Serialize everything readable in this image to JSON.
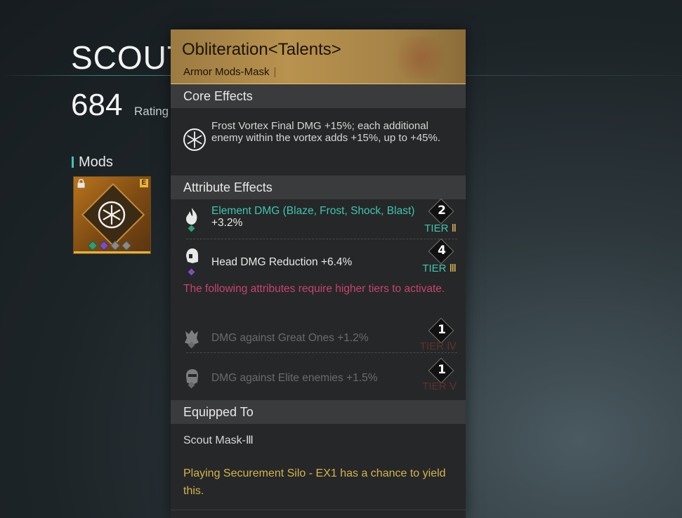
{
  "item": {
    "title": "SCOUT MASK",
    "rating_value": "684",
    "rating_label": "Rating"
  },
  "mods": {
    "label": "Mods",
    "slot_badge": "E",
    "icon": "snowflake-icon",
    "gem_colors": [
      "#2f9e76",
      "#7a4fc0",
      "#8a8a8a",
      "#8a8a8a"
    ]
  },
  "tooltip": {
    "title": "Obliteration<Talents>",
    "subtitle": "Armor Mods-Mask",
    "core_header": "Core Effects",
    "core_text": "Frost Vortex Final DMG +15%; each additional enemy within the vortex adds +15%, up to +45%.",
    "attr_header": "Attribute Effects",
    "attributes": [
      {
        "name": "Element DMG (Blaze, Frost, Shock, Blast)",
        "value": "+3.2%",
        "tier_num": "2",
        "tier_label": "TIER",
        "tier_roman": "Ⅱ",
        "active": true,
        "icon": "flame-icon",
        "gem_color": "#2f9e76"
      },
      {
        "name": "Head DMG Reduction",
        "value": "+6.4%",
        "tier_num": "4",
        "tier_label": "TIER",
        "tier_roman": "Ⅲ",
        "active": true,
        "icon": "helmet-icon",
        "gem_color": "#7a4fc0"
      },
      {
        "name": "DMG against Great Ones",
        "value": "+1.2%",
        "tier_num": "1",
        "tier_label": "TIER",
        "tier_roman": "Ⅳ",
        "active": false,
        "icon": "monster-icon",
        "gem_color": "#6a6a6a"
      },
      {
        "name": "DMG against Elite enemies",
        "value": "+1.5%",
        "tier_num": "1",
        "tier_label": "TIER",
        "tier_roman": "Ⅴ",
        "active": false,
        "icon": "elite-icon",
        "gem_color": "#6a6a6a"
      }
    ],
    "warning": "The following attributes require higher tiers to activate.",
    "equipped_header": "Equipped To",
    "equipped_value": "Scout Mask-Ⅲ",
    "source": "Playing Securement Silo - EX1 has a chance to yield this."
  },
  "colors": {
    "accent_teal": "#3ec5b0",
    "tier_gold": "#e3c35a",
    "warning_pink": "#c8446c",
    "source_gold": "#d3b44c",
    "header_gold": "#b8924e"
  }
}
